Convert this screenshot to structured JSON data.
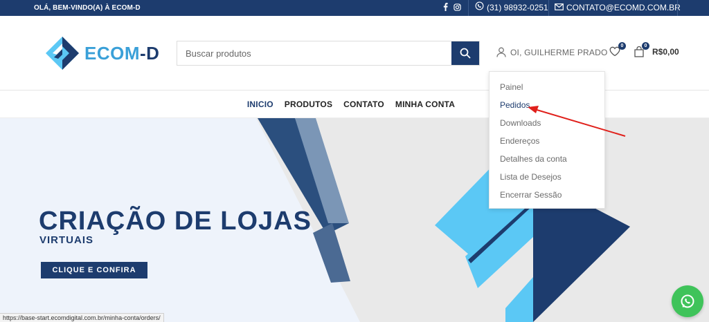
{
  "topbar": {
    "welcome": "OLÁ, BEM-VINDO(A) À ECOM-D",
    "phone": "(31) 98932-0251",
    "email": "CONTATO@ECOMD.COM.BR",
    "icons": [
      "facebook-icon",
      "instagram-icon",
      "whatsapp-icon",
      "mail-icon"
    ]
  },
  "header": {
    "logo_main": "ECOM",
    "logo_dash": "-D",
    "search_placeholder": "Buscar produtos",
    "account_label": "OI, GUILHERME PRADO",
    "wishlist_count": "0",
    "cart_count": "0",
    "cart_total": "R$0,00"
  },
  "nav": {
    "items": [
      {
        "label": "INICIO"
      },
      {
        "label": "PRODUTOS"
      },
      {
        "label": "CONTATO"
      },
      {
        "label": "MINHA CONTA"
      }
    ]
  },
  "account_menu": {
    "items": [
      {
        "label": "Painel"
      },
      {
        "label": "Pedidos"
      },
      {
        "label": "Downloads"
      },
      {
        "label": "Endereços"
      },
      {
        "label": "Detalhes da conta"
      },
      {
        "label": "Lista de Desejos"
      },
      {
        "label": "Encerrar Sessão"
      }
    ]
  },
  "hero": {
    "title": "CRIAÇÃO DE LOJAS",
    "subtitle": "VIRTUAIS",
    "cta": "CLIQUE E CONFIRA"
  },
  "status_url": "https://base-start.ecomdigital.com.br/minha-conta/orders/",
  "colors": {
    "brand_dark": "#1d3c6e",
    "brand_light": "#5bc8f5",
    "annotation": "#e0201b",
    "whatsapp": "#3fc35a"
  }
}
